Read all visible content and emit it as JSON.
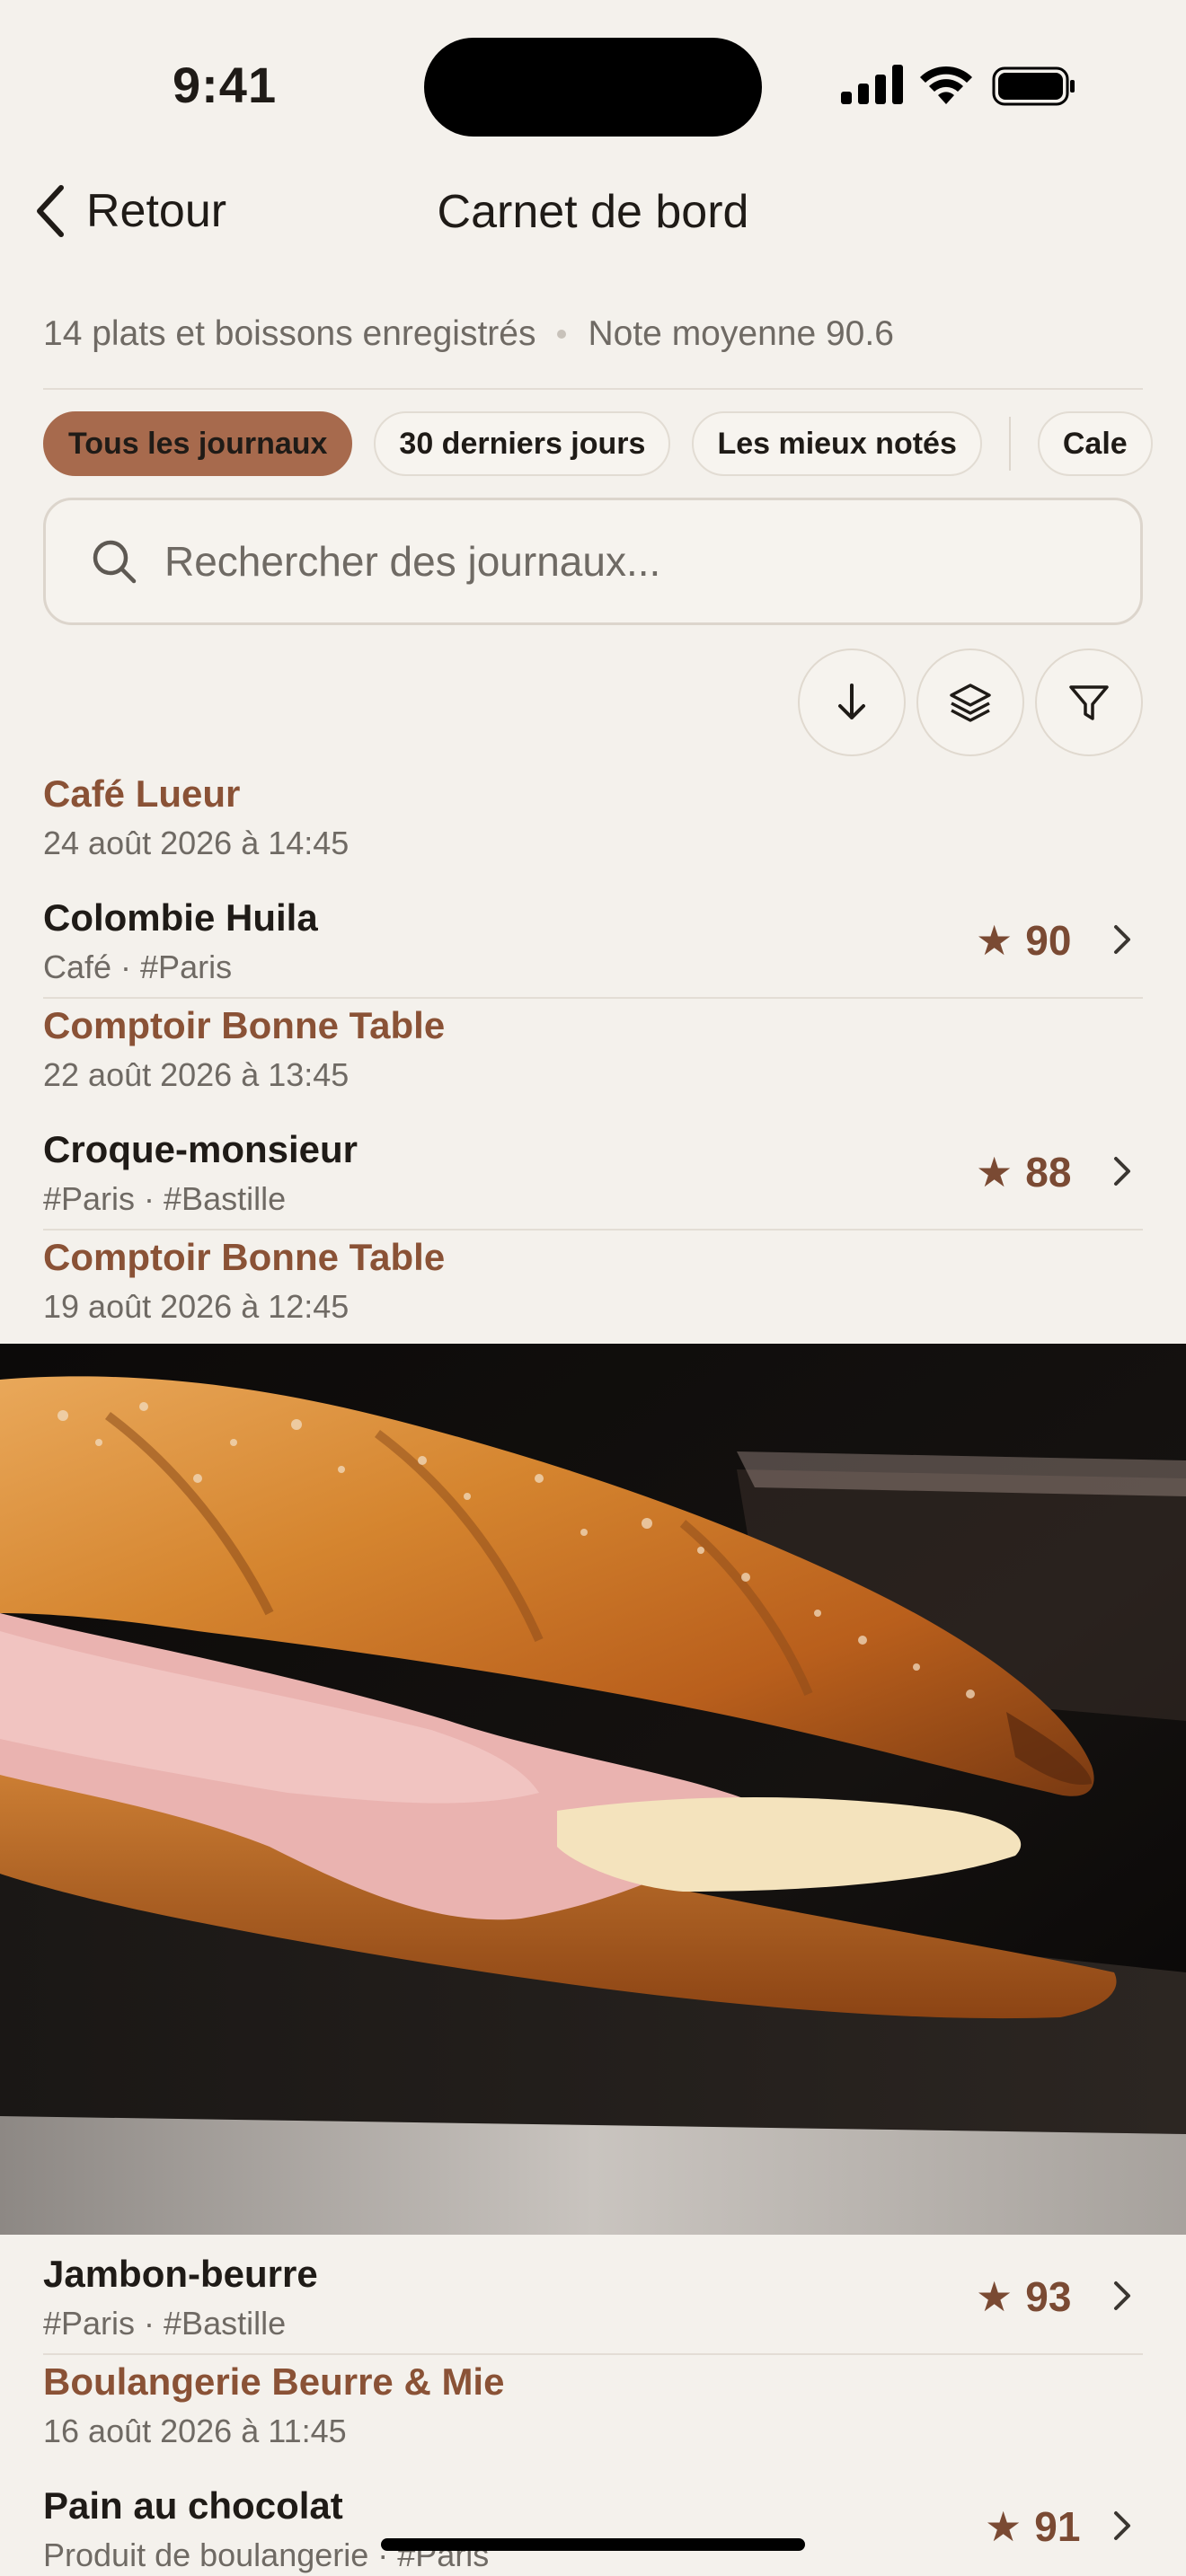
{
  "status": {
    "time": "9:41"
  },
  "nav": {
    "back_label": "Retour",
    "title": "Carnet de bord"
  },
  "summary": {
    "count": "14 plats et boissons enregistrés",
    "average": "Note moyenne 90.6"
  },
  "filters": [
    {
      "label": "Tous les journaux",
      "active": true
    },
    {
      "label": "30 derniers jours",
      "active": false
    },
    {
      "label": "Les mieux notés",
      "active": false
    },
    {
      "label": "Cale",
      "active": false
    }
  ],
  "search": {
    "placeholder": "Rechercher des journaux..."
  },
  "tools": {
    "sort_icon": "arrow-down-icon",
    "group_icon": "layers-icon",
    "filter_icon": "filter-icon"
  },
  "entries": [
    {
      "venue": "Café Lueur",
      "date": "24 août 2026 à 14:45",
      "name": "Colombie Huila",
      "tags": "Café · #Paris",
      "rating": "90"
    },
    {
      "venue": "Comptoir Bonne Table",
      "date": "22 août 2026 à 13:45",
      "name": "Croque-monsieur",
      "tags": "#Paris · #Bastille",
      "rating": "88"
    },
    {
      "venue": "Comptoir Bonne Table",
      "date": "19 août 2026 à 12:45",
      "name": "Jambon-beurre",
      "tags": "#Paris · #Bastille",
      "rating": "93"
    },
    {
      "venue": "Boulangerie Beurre & Mie",
      "date": "16 août 2026 à 11:45",
      "name": "Pain au chocolat",
      "tags": "Produit de boulangerie · #Paris",
      "rating": "91"
    }
  ],
  "colors": {
    "accent": "#a76a4d",
    "venue": "#8a5236",
    "background": "#f4f1ec"
  }
}
